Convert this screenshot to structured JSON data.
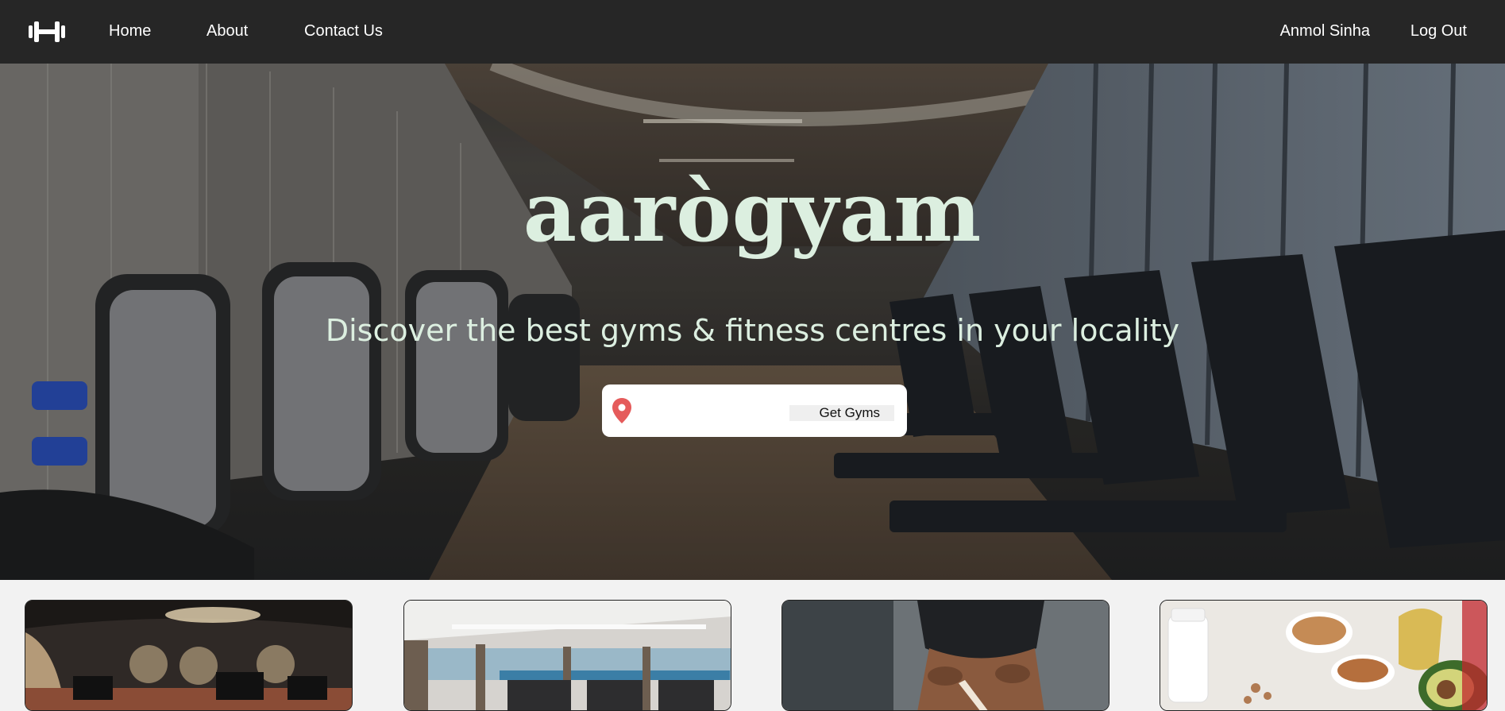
{
  "navbar": {
    "logo_icon": "dumbbell-icon",
    "links": [
      "Home",
      "About",
      "Contact Us"
    ],
    "user_name": "Anmol Sinha",
    "logout_label": "Log Out"
  },
  "hero": {
    "brand": "aarògyam",
    "tagline": "Discover the best gyms & fitness centres in your locality",
    "search": {
      "icon": "location-pin-icon",
      "placeholder": "",
      "value": "",
      "button_label": "Get Gyms"
    }
  },
  "colors": {
    "navbar_bg": "#262626",
    "brand_text": "#dcefe0",
    "pin": "#e55b5b"
  }
}
